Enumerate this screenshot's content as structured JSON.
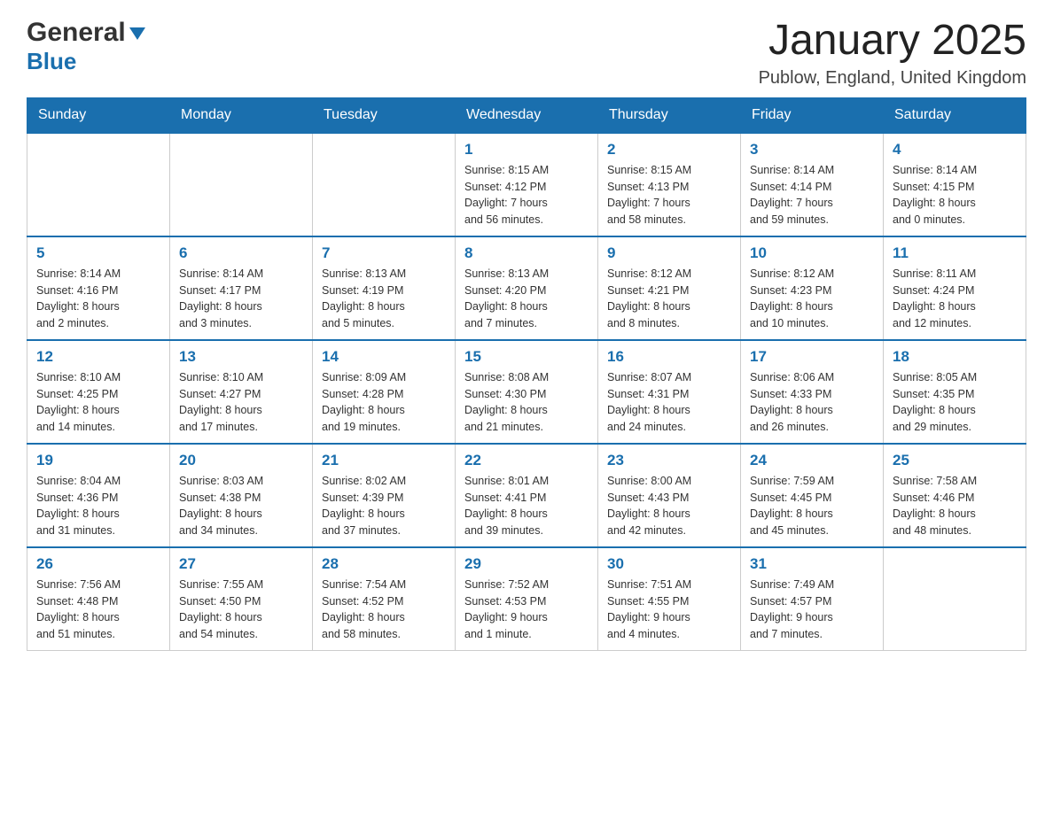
{
  "header": {
    "logo_general": "General",
    "logo_blue": "Blue",
    "title": "January 2025",
    "subtitle": "Publow, England, United Kingdom"
  },
  "days_of_week": [
    "Sunday",
    "Monday",
    "Tuesday",
    "Wednesday",
    "Thursday",
    "Friday",
    "Saturday"
  ],
  "weeks": [
    [
      {
        "day": "",
        "info": ""
      },
      {
        "day": "",
        "info": ""
      },
      {
        "day": "",
        "info": ""
      },
      {
        "day": "1",
        "info": "Sunrise: 8:15 AM\nSunset: 4:12 PM\nDaylight: 7 hours\nand 56 minutes."
      },
      {
        "day": "2",
        "info": "Sunrise: 8:15 AM\nSunset: 4:13 PM\nDaylight: 7 hours\nand 58 minutes."
      },
      {
        "day": "3",
        "info": "Sunrise: 8:14 AM\nSunset: 4:14 PM\nDaylight: 7 hours\nand 59 minutes."
      },
      {
        "day": "4",
        "info": "Sunrise: 8:14 AM\nSunset: 4:15 PM\nDaylight: 8 hours\nand 0 minutes."
      }
    ],
    [
      {
        "day": "5",
        "info": "Sunrise: 8:14 AM\nSunset: 4:16 PM\nDaylight: 8 hours\nand 2 minutes."
      },
      {
        "day": "6",
        "info": "Sunrise: 8:14 AM\nSunset: 4:17 PM\nDaylight: 8 hours\nand 3 minutes."
      },
      {
        "day": "7",
        "info": "Sunrise: 8:13 AM\nSunset: 4:19 PM\nDaylight: 8 hours\nand 5 minutes."
      },
      {
        "day": "8",
        "info": "Sunrise: 8:13 AM\nSunset: 4:20 PM\nDaylight: 8 hours\nand 7 minutes."
      },
      {
        "day": "9",
        "info": "Sunrise: 8:12 AM\nSunset: 4:21 PM\nDaylight: 8 hours\nand 8 minutes."
      },
      {
        "day": "10",
        "info": "Sunrise: 8:12 AM\nSunset: 4:23 PM\nDaylight: 8 hours\nand 10 minutes."
      },
      {
        "day": "11",
        "info": "Sunrise: 8:11 AM\nSunset: 4:24 PM\nDaylight: 8 hours\nand 12 minutes."
      }
    ],
    [
      {
        "day": "12",
        "info": "Sunrise: 8:10 AM\nSunset: 4:25 PM\nDaylight: 8 hours\nand 14 minutes."
      },
      {
        "day": "13",
        "info": "Sunrise: 8:10 AM\nSunset: 4:27 PM\nDaylight: 8 hours\nand 17 minutes."
      },
      {
        "day": "14",
        "info": "Sunrise: 8:09 AM\nSunset: 4:28 PM\nDaylight: 8 hours\nand 19 minutes."
      },
      {
        "day": "15",
        "info": "Sunrise: 8:08 AM\nSunset: 4:30 PM\nDaylight: 8 hours\nand 21 minutes."
      },
      {
        "day": "16",
        "info": "Sunrise: 8:07 AM\nSunset: 4:31 PM\nDaylight: 8 hours\nand 24 minutes."
      },
      {
        "day": "17",
        "info": "Sunrise: 8:06 AM\nSunset: 4:33 PM\nDaylight: 8 hours\nand 26 minutes."
      },
      {
        "day": "18",
        "info": "Sunrise: 8:05 AM\nSunset: 4:35 PM\nDaylight: 8 hours\nand 29 minutes."
      }
    ],
    [
      {
        "day": "19",
        "info": "Sunrise: 8:04 AM\nSunset: 4:36 PM\nDaylight: 8 hours\nand 31 minutes."
      },
      {
        "day": "20",
        "info": "Sunrise: 8:03 AM\nSunset: 4:38 PM\nDaylight: 8 hours\nand 34 minutes."
      },
      {
        "day": "21",
        "info": "Sunrise: 8:02 AM\nSunset: 4:39 PM\nDaylight: 8 hours\nand 37 minutes."
      },
      {
        "day": "22",
        "info": "Sunrise: 8:01 AM\nSunset: 4:41 PM\nDaylight: 8 hours\nand 39 minutes."
      },
      {
        "day": "23",
        "info": "Sunrise: 8:00 AM\nSunset: 4:43 PM\nDaylight: 8 hours\nand 42 minutes."
      },
      {
        "day": "24",
        "info": "Sunrise: 7:59 AM\nSunset: 4:45 PM\nDaylight: 8 hours\nand 45 minutes."
      },
      {
        "day": "25",
        "info": "Sunrise: 7:58 AM\nSunset: 4:46 PM\nDaylight: 8 hours\nand 48 minutes."
      }
    ],
    [
      {
        "day": "26",
        "info": "Sunrise: 7:56 AM\nSunset: 4:48 PM\nDaylight: 8 hours\nand 51 minutes."
      },
      {
        "day": "27",
        "info": "Sunrise: 7:55 AM\nSunset: 4:50 PM\nDaylight: 8 hours\nand 54 minutes."
      },
      {
        "day": "28",
        "info": "Sunrise: 7:54 AM\nSunset: 4:52 PM\nDaylight: 8 hours\nand 58 minutes."
      },
      {
        "day": "29",
        "info": "Sunrise: 7:52 AM\nSunset: 4:53 PM\nDaylight: 9 hours\nand 1 minute."
      },
      {
        "day": "30",
        "info": "Sunrise: 7:51 AM\nSunset: 4:55 PM\nDaylight: 9 hours\nand 4 minutes."
      },
      {
        "day": "31",
        "info": "Sunrise: 7:49 AM\nSunset: 4:57 PM\nDaylight: 9 hours\nand 7 minutes."
      },
      {
        "day": "",
        "info": ""
      }
    ]
  ]
}
